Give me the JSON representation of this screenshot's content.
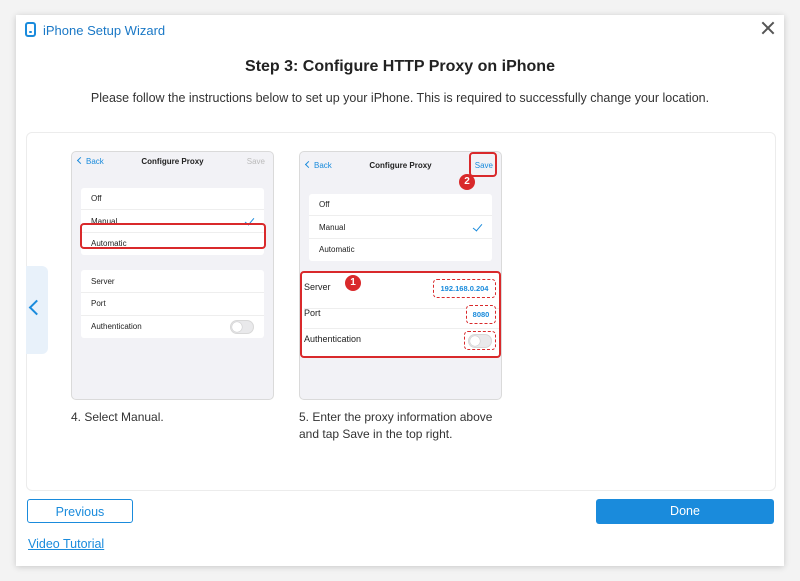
{
  "window": {
    "title": "iPhone Setup Wizard",
    "close_icon": "close-icon"
  },
  "header": {
    "step_title": "Step 3: Configure HTTP Proxy on iPhone",
    "subtitle": "Please follow the instructions below to set up your iPhone. This is required to successfully change your location."
  },
  "phone1": {
    "back": "Back",
    "title": "Configure Proxy",
    "save": "Save",
    "modes": [
      "Off",
      "Manual",
      "Automatic"
    ],
    "fields": [
      "Server",
      "Port",
      "Authentication"
    ],
    "caption": "4. Select Manual."
  },
  "phone2": {
    "back": "Back",
    "title": "Configure Proxy",
    "save": "Save",
    "modes": [
      "Off",
      "Manual",
      "Automatic"
    ],
    "fields": [
      "Server",
      "Port",
      "Authentication"
    ],
    "server_value": "192.168.0.204",
    "port_value": "8080",
    "badge1": "1",
    "badge2": "2",
    "caption_line1": "5. Enter the proxy information above",
    "caption_line2": "and tap Save in the top right."
  },
  "footer": {
    "previous": "Previous",
    "done": "Done",
    "video_tutorial": "Video Tutorial"
  },
  "colors": {
    "accent": "#1a8bdc",
    "highlight": "#d9292b"
  }
}
